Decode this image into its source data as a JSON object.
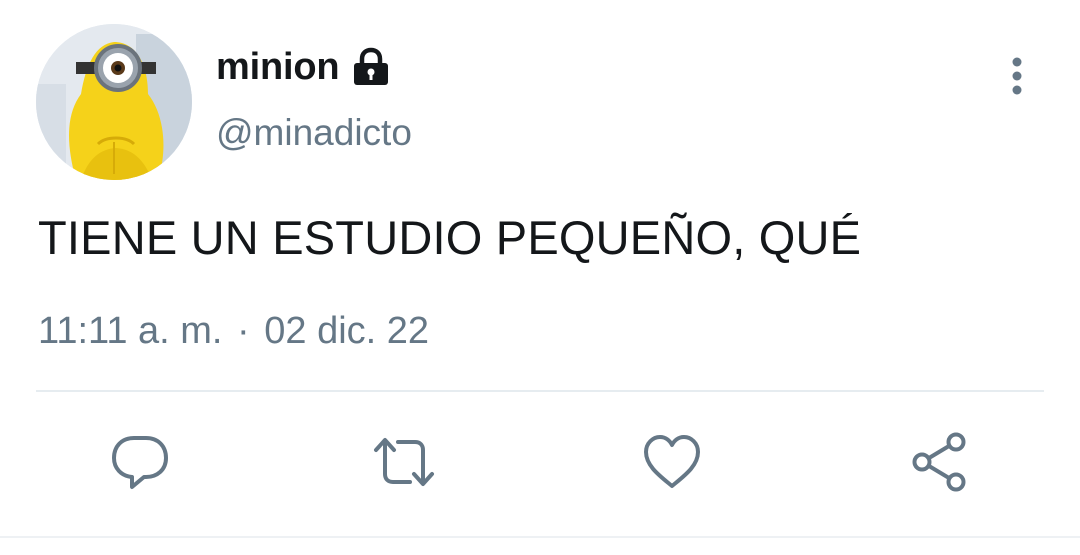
{
  "tweet": {
    "author": {
      "display_name": "minion",
      "handle": "@minadicto",
      "avatar_icon": "minion-avatar",
      "protected_icon": "lock-icon"
    },
    "text": "TIENE UN ESTUDIO PEQUEÑO, QUÉ",
    "time": "11:11 a. m.",
    "separator": "·",
    "date": "02 dic. 22",
    "more_icon": "more-vertical-icon"
  },
  "actions": [
    {
      "icon": "reply-icon"
    },
    {
      "icon": "retweet-icon"
    },
    {
      "icon": "like-icon"
    },
    {
      "icon": "share-icon"
    }
  ],
  "colors": {
    "text_primary": "#14171a",
    "text_secondary": "#657786",
    "icon": "#657786",
    "divider": "#e6ecf0",
    "avatar_yellow": "#f5d21a"
  }
}
